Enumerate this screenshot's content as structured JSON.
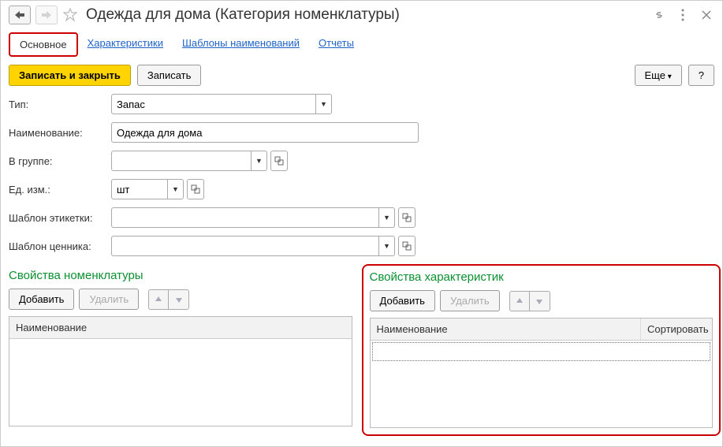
{
  "title": "Одежда для дома (Категория номенклатуры)",
  "tabs": [
    {
      "label": "Основное",
      "active": true
    },
    {
      "label": "Характеристики",
      "active": false
    },
    {
      "label": "Шаблоны наименований",
      "active": false
    },
    {
      "label": "Отчеты",
      "active": false
    }
  ],
  "toolbar": {
    "save_close": "Записать и закрыть",
    "save": "Записать",
    "more": "Еще",
    "help": "?"
  },
  "form": {
    "type_label": "Тип:",
    "type_value": "Запас",
    "name_label": "Наименование:",
    "name_value": "Одежда для дома",
    "group_label": "В группе:",
    "group_value": "",
    "unit_label": "Ед. изм.:",
    "unit_value": "шт",
    "label_tpl_label": "Шаблон этикетки:",
    "label_tpl_value": "",
    "price_tpl_label": "Шаблон ценника:",
    "price_tpl_value": ""
  },
  "panels": {
    "nomenclature": {
      "title": "Свойства номенклатуры",
      "add": "Добавить",
      "del": "Удалить",
      "col_name": "Наименование"
    },
    "characteristics": {
      "title": "Свойства характеристик",
      "add": "Добавить",
      "del": "Удалить",
      "col_name": "Наименование",
      "col_sort": "Сортировать"
    }
  }
}
